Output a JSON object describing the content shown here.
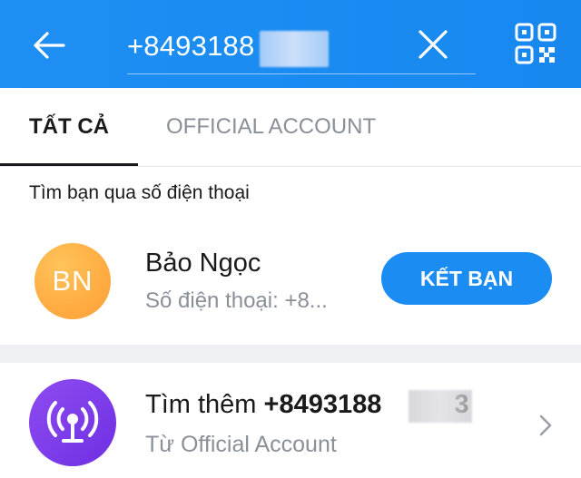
{
  "header": {
    "search_value": "+8493188",
    "icons": {
      "back": "arrow-left-icon",
      "clear": "close-icon",
      "qr": "qr-code-icon"
    },
    "colors": {
      "background": "#1a8cf2"
    }
  },
  "tabs": [
    {
      "label": "TẤT CẢ",
      "active": true
    },
    {
      "label": "OFFICIAL ACCOUNT",
      "active": false
    }
  ],
  "section": {
    "title": "Tìm bạn qua số điện thoại"
  },
  "result": {
    "avatar_initials": "BN",
    "name": "Bảo Ngọc",
    "subtitle": "Số điện thoại: +8...",
    "action_label": "KẾT BẠN",
    "colors": {
      "avatar": "#ffae44",
      "button": "#1a8cf2"
    }
  },
  "more": {
    "prefix": "Tìm thêm",
    "query": "+8493188",
    "suffix": "3",
    "subtitle": "Từ Official Account",
    "icon": "broadcast-tower-icon",
    "colors": {
      "avatar": "#7b3aea"
    }
  }
}
